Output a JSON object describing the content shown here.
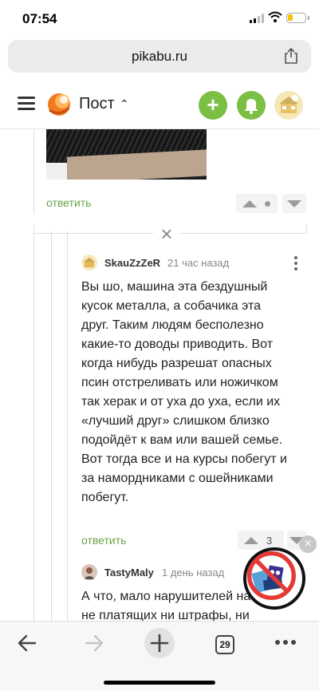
{
  "status_bar": {
    "time": "07:54"
  },
  "browser": {
    "url": "pikabu.ru",
    "tabs_count": "29"
  },
  "header": {
    "section_title": "Пост"
  },
  "colors": {
    "accent": "#7bbf45",
    "reply_link": "#6aa34a"
  },
  "thread": {
    "first_reply_label": "ответить",
    "comment1": {
      "username": "SkauZzZeR",
      "time": "21 час назад",
      "lines": [
        "Вы шо, машина эта бездушный",
        "кусок металла, а собачика эта",
        "друг. Таким людям бесполезно",
        "какие-то доводы приводить. Вот",
        "когда нибудь разрешат опасных",
        "псин отстреливать или ножичком",
        "так херак и от уха до уха, если их",
        "«лучший друг» слишком близко",
        "подойдёт к вам или вашей семье.",
        "Вот тогда все и на курсы побегут и",
        "за намордниками с ошейниками",
        "побегут."
      ],
      "reply_label": "ответить",
      "score": "3"
    },
    "comment2": {
      "username": "TastyMaly",
      "time": "1 день назад",
      "lines": [
        "А что, мало нарушителей на",
        "не платящих ни штрафы, ни"
      ]
    }
  },
  "icons": {
    "share": "share-icon",
    "menu": "hamburger-icon",
    "add": "plus-icon",
    "notifications": "bell-icon",
    "collapse": "close-icon",
    "more": "kebab-icon",
    "back": "arrow-left-icon",
    "forward": "arrow-right-icon",
    "new_tab": "plus-icon"
  }
}
